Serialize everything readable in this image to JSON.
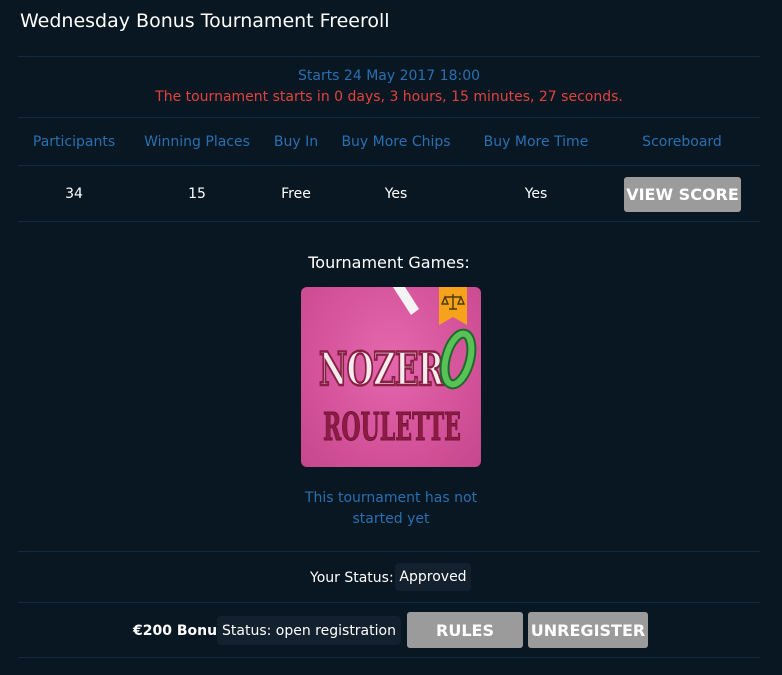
{
  "title": "Wednesday Bonus Tournament Freeroll",
  "schedule": {
    "starts": "Starts 24 May 2017 18:00",
    "countdown": "The tournament starts in 0 days, 3 hours, 15 minutes, 27 seconds."
  },
  "info_table": {
    "headers": [
      "Participants",
      "Winning Places",
      "Buy In",
      "Buy More Chips",
      "Buy More Time",
      "Scoreboard"
    ],
    "values": [
      "34",
      "15",
      "Free",
      "Yes",
      "Yes"
    ],
    "view_score_label": "VIEW SCORE"
  },
  "games": {
    "label": "Tournament Games:",
    "game_name": "NOZERO ROULETTE",
    "logo_word_top": "NOZER",
    "logo_word_zero": "0",
    "logo_word_bottom": "ROULETTE",
    "badge_icon": "scales-icon",
    "not_started_line1": "This tournament has not",
    "not_started_line2": "started yet"
  },
  "status": {
    "label": "Your Status:",
    "value": "Approved"
  },
  "bonus": {
    "label": "€200 Bonus",
    "registration_status": "Status: open registration",
    "rules_label": "RULES",
    "unregister_label": "UNREGISTER"
  },
  "colors": {
    "background": "#081722",
    "accent_blue": "#2a6fb0",
    "countdown_red": "#e0433f",
    "button_gray": "#9b9b9b",
    "pill_bg": "#13202e",
    "thumb_pink": "#d5549b"
  }
}
